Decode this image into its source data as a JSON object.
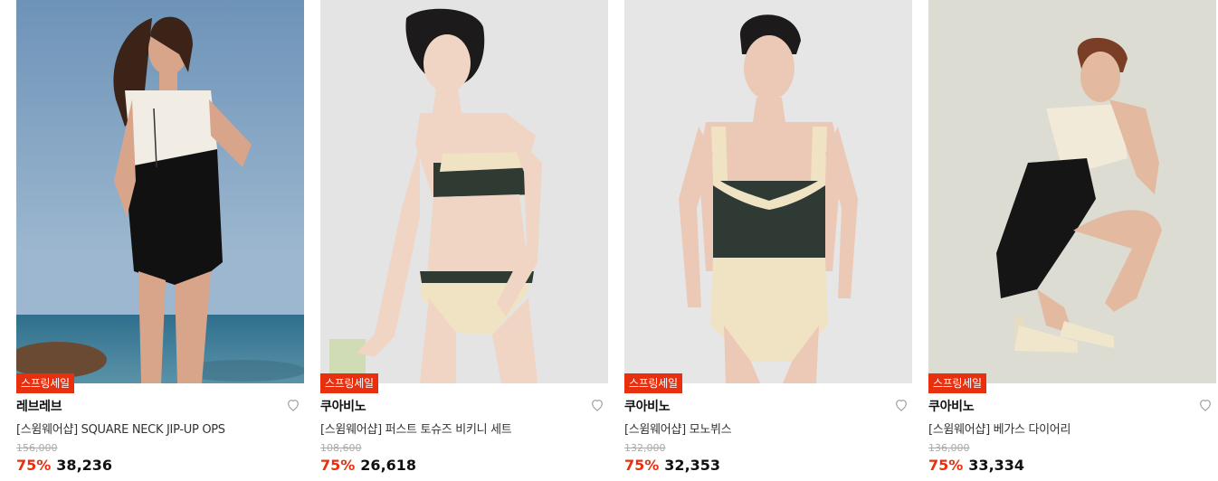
{
  "products": [
    {
      "badge": "스프링세일",
      "brand": "레브레브",
      "name": "[스윔웨어샵] SQUARE NECK JIP-UP OPS",
      "original_price": "156,000",
      "discount": "75%",
      "price": "38,236",
      "image": "model-photo-beach"
    },
    {
      "badge": "스프링세일",
      "brand": "쿠아비노",
      "name": "[스윔웨어샵] 퍼스트 토슈즈 비키니 세트",
      "original_price": "108,600",
      "discount": "75%",
      "price": "26,618",
      "image": "model-photo-studio"
    },
    {
      "badge": "스프링세일",
      "brand": "쿠아비노",
      "name": "[스윔웨어샵] 모노뷔스",
      "original_price": "132,000",
      "discount": "75%",
      "price": "32,353",
      "image": "model-photo-studio"
    },
    {
      "badge": "스프링세일",
      "brand": "쿠아비노",
      "name": "[스윔웨어샵] 베가스 다이어리",
      "original_price": "136,000",
      "discount": "75%",
      "price": "33,334",
      "image": "model-photo-studio"
    }
  ],
  "colors": {
    "accent": "#e8300f",
    "original_price": "#aaaaaa",
    "text": "#111111"
  },
  "icons": {
    "wishlist": "heart-outline-icon"
  }
}
